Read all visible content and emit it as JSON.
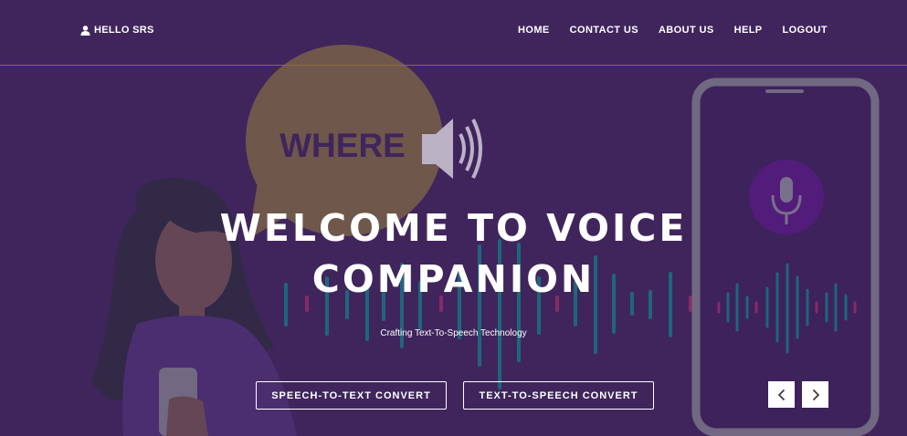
{
  "header": {
    "greeting": "HELLO SRS",
    "nav": [
      {
        "label": "HOME"
      },
      {
        "label": "CONTACT US"
      },
      {
        "label": "ABOUT US"
      },
      {
        "label": "HELP"
      },
      {
        "label": "LOGOUT"
      }
    ]
  },
  "hero": {
    "bubble_text": "WHERE",
    "title_line1": "WELCOME TO VOICE",
    "title_line2": "COMPANION",
    "tagline": "Crafting Text-To-Speech Technology",
    "buttons": {
      "speech_to_text": "SPEECH-TO-TEXT CONVERT",
      "text_to_speech": "TEXT-TO-SPEECH CONVERT"
    }
  },
  "carousel": {
    "prev_icon": "chevron-left-icon",
    "next_icon": "chevron-right-icon"
  },
  "icons": {
    "user": "user-icon",
    "speaker": "speaker-icon",
    "microphone": "microphone-icon"
  },
  "colors": {
    "background": "#43275f",
    "bubble": "#8a7342",
    "teal_wave": "#0f8a8c",
    "accent_pink": "#b0306d",
    "mic_circle": "#5e1a8c",
    "phone": "#8e8e96"
  }
}
